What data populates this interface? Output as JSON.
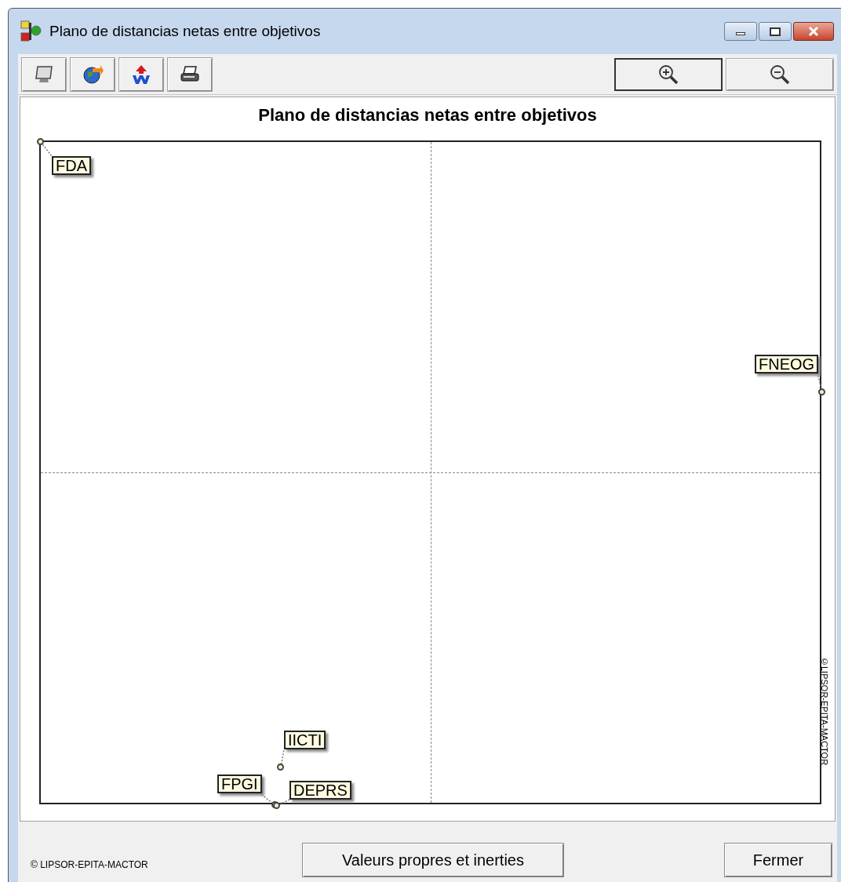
{
  "window": {
    "title": "Plano de distancias netas entre objetivos"
  },
  "chart": {
    "title": "Plano de distancias netas entre objetivos",
    "points": [
      {
        "label": "FDA"
      },
      {
        "label": "FNEOG"
      },
      {
        "label": "IICTI"
      },
      {
        "label": "FPGI"
      },
      {
        "label": "DEPRS"
      }
    ],
    "side_note": "©LIPSOR-EPITA-MACTOR"
  },
  "footer": {
    "note": "© LIPSOR-EPITA-MACTOR",
    "buttons": [
      "Valeurs propres et inerties",
      "Fermer"
    ]
  }
}
